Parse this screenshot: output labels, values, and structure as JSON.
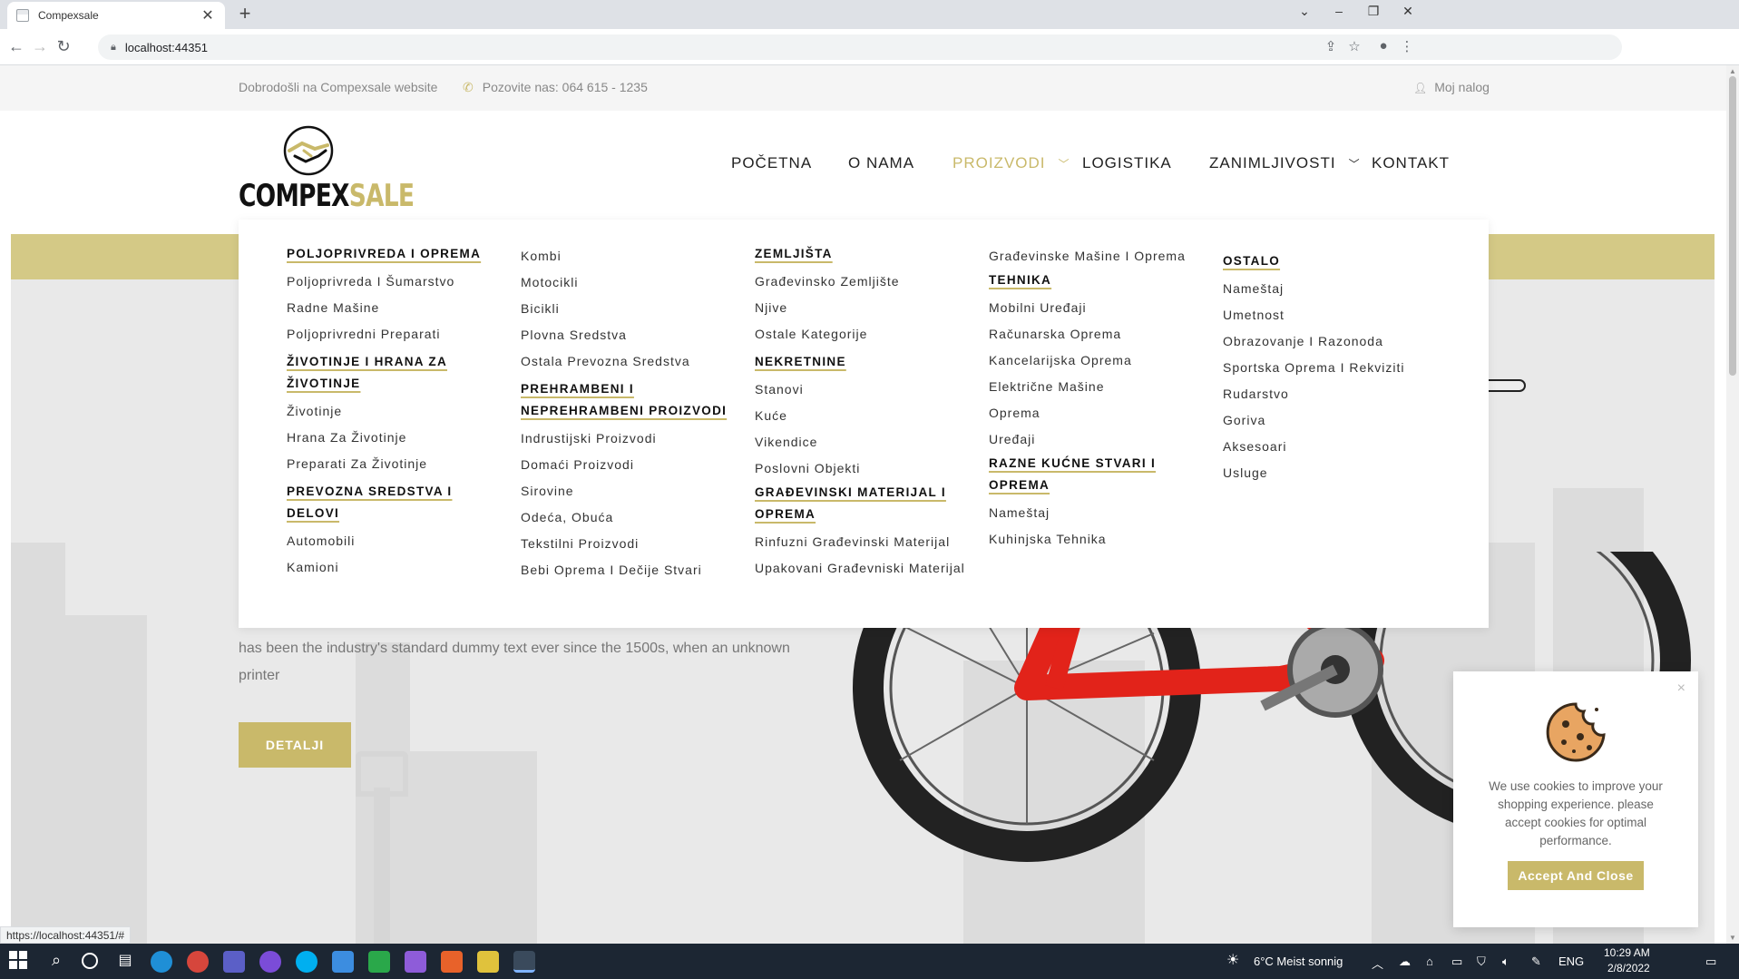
{
  "browser": {
    "tab_title": "Compexsale",
    "tab_close": "✕",
    "new_tab": "+",
    "url": "localhost:44351",
    "status_url": "https://localhost:44351/#"
  },
  "topbar": {
    "welcome": "Dobrodošli na Compexsale website",
    "phone": "Pozovite nas: 064 615 - 1235",
    "account": "Moj nalog"
  },
  "logo": {
    "part1": "COMPEX",
    "part2": "SALE"
  },
  "nav": {
    "items": [
      {
        "label": "POČETNA"
      },
      {
        "label": "O NAMA"
      },
      {
        "label": "PROIZVODI"
      },
      {
        "label": "LOGISTIKA"
      },
      {
        "label": "ZANIMLJIVOSTI"
      },
      {
        "label": "KONTAKT"
      }
    ]
  },
  "mega_menu": {
    "col1": {
      "g1": {
        "head": "POLJOPRIVREDA I OPREMA",
        "links": [
          "Poljoprivreda I Šumarstvo",
          "Radne Mašine",
          "Poljoprivredni Preparati"
        ]
      },
      "g2": {
        "head": "ŽIVOTINJE I HRANA ZA ŽIVOTINJE",
        "links": [
          "Životinje",
          "Hrana Za Životinje",
          "Preparati Za Životinje"
        ]
      },
      "g3": {
        "head": "PREVOZNA SREDSTVA I DELOVI",
        "links": [
          "Automobili",
          "Kamioni"
        ]
      }
    },
    "col2": {
      "g0": {
        "links": [
          "Kombi",
          "Motocikli",
          "Bicikli",
          "Plovna Sredstva",
          "Ostala Prevozna Sredstva"
        ]
      },
      "g1": {
        "head": "PREHRAMBENI I NEPREHRAMBENI PROIZVODI",
        "links": [
          "Indrustijski Proizvodi",
          "Domaći Proizvodi",
          "Sirovine",
          "Odeća, Obuća",
          "Tekstilni Proizvodi",
          "Bebi Oprema I Dečije Stvari"
        ]
      }
    },
    "col3": {
      "g1": {
        "head": "ZEMLJIŠTA",
        "links": [
          "Građevinsko Zemljište",
          "Njive",
          "Ostale Kategorije"
        ]
      },
      "g2": {
        "head": "NEKRETNINE",
        "links": [
          "Stanovi",
          "Kuće",
          "Vikendice",
          "Poslovni Objekti"
        ]
      },
      "g3": {
        "head": "GRAĐEVINSKI MATERIJAL I OPREMA",
        "links": [
          "Rinfuzni Građevinski Materijal",
          "Upakovani Građevniski Materijal"
        ]
      }
    },
    "col4": {
      "g0": {
        "links": [
          "Građevinske Mašine I Oprema"
        ]
      },
      "g1": {
        "head": "TEHNIKA",
        "links": [
          "Mobilni Uređaji",
          "Računarska Oprema",
          "Kancelarijska Oprema",
          "Električne Mašine",
          "Oprema",
          "Uređaji"
        ]
      },
      "g2": {
        "head": "RAZNE KUĆNE STVARI I OPREMA",
        "links": [
          "Nameštaj",
          "Kuhinjska Tehnika"
        ]
      }
    },
    "col5": {
      "g1": {
        "head": "OSTALO",
        "links": [
          "Nameštaj",
          "Umetnost",
          "Obrazovanje I Razonoda",
          "Sportska Oprema I Rekviziti",
          "Rudarstvo",
          "Goriva",
          "Aksesoari",
          "Usluge"
        ]
      }
    }
  },
  "hero": {
    "text": "has been the industry's standard dummy text ever since the 1500s, when an unknown printer",
    "button": "DETALJI"
  },
  "cookie": {
    "close": "×",
    "message": "We use cookies to improve your shopping experience. please accept cookies for optimal performance.",
    "accept": "Accept And Close"
  },
  "taskbar": {
    "weather": "6°C  Meist sonnig",
    "lang": "ENG",
    "time": "10:29 AM",
    "date": "2/8/2022"
  },
  "colors": {
    "gold": "#c9b96a",
    "band": "#d4c986",
    "taskbar": "#1c2633"
  }
}
